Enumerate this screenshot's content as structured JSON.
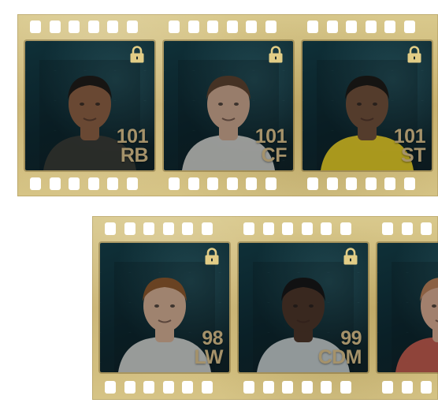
{
  "colors": {
    "film_gold": "#cdb877",
    "frame_dark": "#0f3038",
    "rating_text": "#a5926a",
    "lock_gold": "#e2cd86"
  },
  "strips": [
    {
      "cards": [
        {
          "rating": "101",
          "position": "RB",
          "skin": "#8a5a3c",
          "hair": "#1c1612",
          "shirt": "#3a3630",
          "locked": true,
          "icon": "lock-icon"
        },
        {
          "rating": "101",
          "position": "CF",
          "skin": "#c9a087",
          "hair": "#5a3d28",
          "shirt": "#d8d5cf",
          "locked": true,
          "icon": "lock-icon"
        },
        {
          "rating": "101",
          "position": "ST",
          "skin": "#6e4a33",
          "hair": "#1a1410",
          "shirt": "#f2d21f",
          "locked": true,
          "icon": "lock-icon"
        }
      ]
    },
    {
      "cards": [
        {
          "rating": "98",
          "position": "LW",
          "skin": "#d2a98d",
          "hair": "#8a5226",
          "shirt": "#d9d7d2",
          "locked": true,
          "icon": "lock-icon"
        },
        {
          "rating": "99",
          "position": "CDM",
          "skin": "#4a2f22",
          "hair": "#141010",
          "shirt": "#cfd3d2",
          "locked": true,
          "icon": "lock-icon"
        },
        {
          "rating": "",
          "position": "",
          "skin": "#d6a58a",
          "hair": "#b77a52",
          "shirt": "#cc5a4a",
          "locked": false,
          "icon": ""
        }
      ]
    }
  ]
}
